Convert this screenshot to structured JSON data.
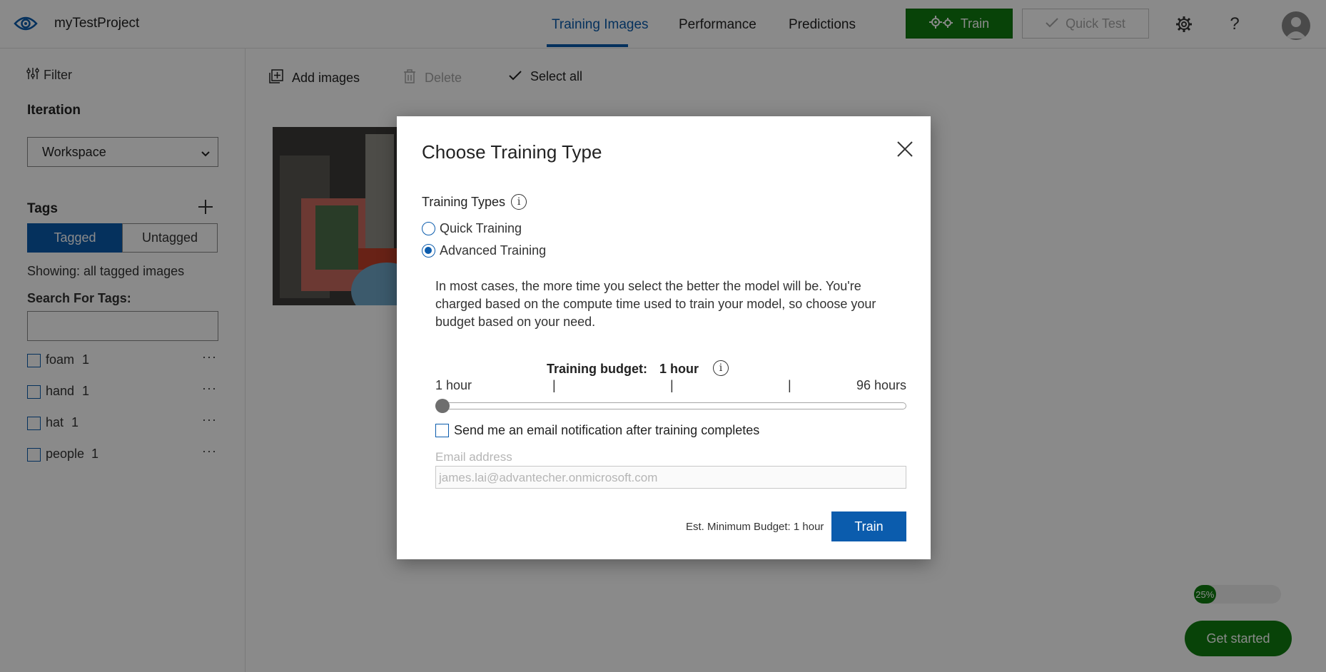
{
  "app": {
    "project_name": "myTestProject",
    "logo_icon": "eye-icon"
  },
  "nav": {
    "tabs": [
      {
        "label": "Training Images",
        "active": true
      },
      {
        "label": "Performance",
        "active": false
      },
      {
        "label": "Predictions",
        "active": false
      }
    ],
    "train_label": "Train",
    "quick_test_label": "Quick Test",
    "settings_icon": "gear-icon",
    "help_label": "?",
    "avatar_icon": "user-avatar-icon"
  },
  "sidebar": {
    "filter_label": "Filter",
    "iteration_heading": "Iteration",
    "iteration_selected": "Workspace",
    "tags_heading": "Tags",
    "tagged_label": "Tagged",
    "untagged_label": "Untagged",
    "showing_text": "Showing: all tagged images",
    "search_label": "Search For Tags:",
    "search_value": "",
    "tags": [
      {
        "name": "foam",
        "count": "1"
      },
      {
        "name": "hand",
        "count": "1"
      },
      {
        "name": "hat",
        "count": "1"
      },
      {
        "name": "people",
        "count": "1"
      }
    ],
    "more_glyph": "···"
  },
  "toolbar": {
    "add_images_label": "Add images",
    "delete_label": "Delete",
    "select_all_label": "Select all"
  },
  "progress": {
    "label": "25%",
    "value_fraction": 0.25
  },
  "get_started_label": "Get started",
  "dialog": {
    "title": "Choose Training Type",
    "training_types_label": "Training Types",
    "options": [
      {
        "label": "Quick Training",
        "checked": false
      },
      {
        "label": "Advanced Training",
        "checked": true
      }
    ],
    "description": "In most cases, the more time you select the better the model will be. You're charged based on the compute time used to train your model, so choose your budget based on your need.",
    "budget_label": "Training budget:",
    "budget_value": "1 hour",
    "slider_min_label": "1 hour",
    "slider_max_label": "96 hours",
    "slider_tick_glyph": "|",
    "slider_value_fraction": 0,
    "email_checkbox_label": "Send me an email notification after training completes",
    "email_checked": false,
    "email_field_label": "Email address",
    "email_value": "james.lai@advantecher.onmicrosoft.com",
    "est_budget_text": "Est. Minimum Budget: 1 hour",
    "train_button_label": "Train"
  },
  "colors": {
    "brand_blue": "#0b5cad",
    "train_green": "#107c10",
    "overlay": "rgba(0,0,0,0.46)"
  }
}
